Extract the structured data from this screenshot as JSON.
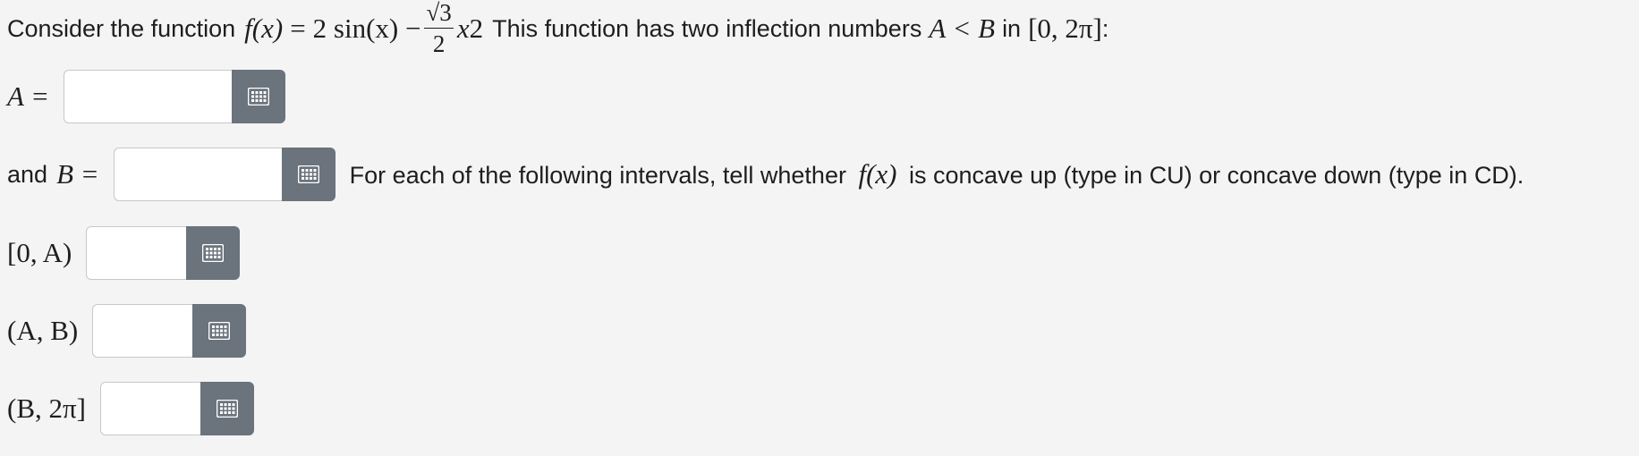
{
  "question": {
    "intro": "Consider the function",
    "f_lhs": "f(x)",
    "equals": "=",
    "term1": "2 sin(x) −",
    "frac_num": "√3",
    "frac_den": "2",
    "x_var": "x",
    "exp": "2",
    "after_func": "This function has two inflection numbers",
    "A_lt_B": "A < B",
    "in_word": "in",
    "interval": "[0, 2π]",
    "colon": ":"
  },
  "A_row": {
    "label": "A ="
  },
  "B_row": {
    "prefix": "and",
    "label": "B ="
  },
  "instruction": {
    "before": "For each of the following intervals, tell whether",
    "fx": "f(x)",
    "after": "is concave up (type in CU) or concave down (type in CD)."
  },
  "intervals": [
    {
      "label": "[0, A)"
    },
    {
      "label": "(A, B)"
    },
    {
      "label": "(B, 2π]"
    }
  ],
  "inputs": {
    "A_value": "",
    "B_value": "",
    "i1_value": "",
    "i2_value": "",
    "i3_value": ""
  },
  "icons": {
    "keyboard": "grid-keyboard-icon"
  }
}
